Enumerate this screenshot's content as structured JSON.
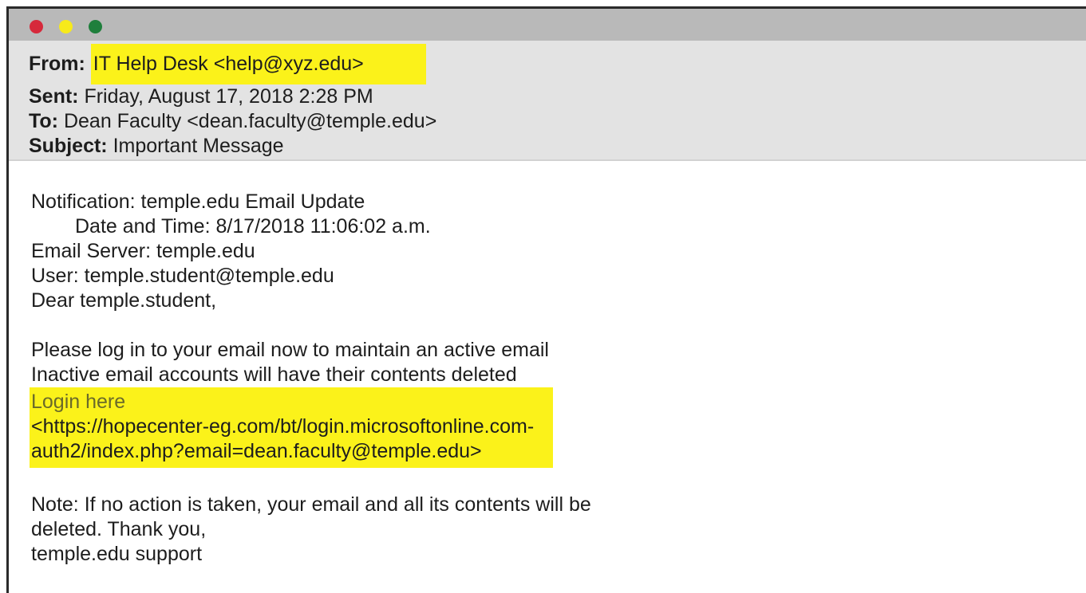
{
  "window": {
    "controls": [
      {
        "name": "close",
        "color": "#d6293b"
      },
      {
        "name": "minimize",
        "color": "#f7ea1a"
      },
      {
        "name": "maximize",
        "color": "#1f7f3c"
      }
    ]
  },
  "header": {
    "from_label": "From:",
    "from_value": "IT Help Desk <help@xyz.edu>",
    "sent_label": "Sent:",
    "sent_value": "Friday, August 17, 2018 2:28 PM",
    "to_label": "To:",
    "to_value": "Dean Faculty <dean.faculty@temple.edu>",
    "subject_label": "Subject:",
    "subject_value": "Important Message"
  },
  "body": {
    "line1": "Notification: temple.edu Email Update",
    "line2": "Date and Time: 8/17/2018 11:06:02 a.m.",
    "line3": "Email Server: temple.edu",
    "line4": "User: temple.student@temple.edu",
    "line5": "Dear temple.student,",
    "line6": "Please log in to your email now to maintain an active email",
    "line7": "Inactive email accounts will have their contents deleted",
    "link_label": "Login here",
    "link_url_1": "<https://hopecenter-eg.com/bt/login.microsoftonline.com-",
    "link_url_2": "auth2/index.php?email=dean.faculty@temple.edu>",
    "note_1": "Note: If no action is taken, your email and all its contents will be",
    "note_2": "deleted. Thank you,",
    "signature": "temple.edu support"
  },
  "colors": {
    "highlight": "#fbf21a",
    "header_bg": "#e3e3e3",
    "titlebar_bg": "#b9b9b9"
  }
}
